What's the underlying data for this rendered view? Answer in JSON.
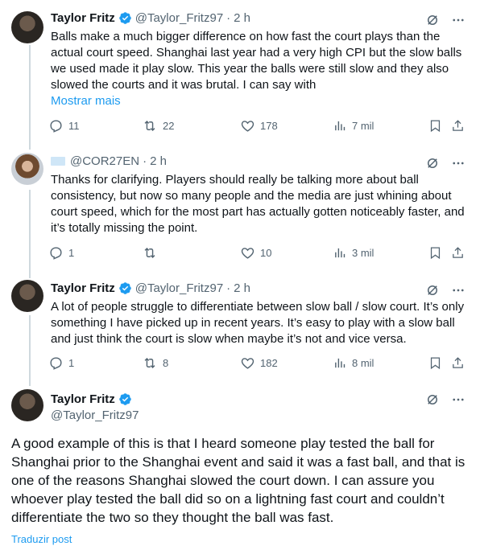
{
  "tweets": [
    {
      "name": "Taylor Fritz",
      "handle": "@Taylor_Fritz97",
      "dot": "·",
      "time": "2 h",
      "text": "Balls make a much bigger difference on how fast the court plays than the actual court speed. Shanghai last year had a very high CPI but the slow balls we used made it play slow. This year the balls were still slow and they also slowed the courts and it was brutal. I can say with",
      "more": "Mostrar mais",
      "replies": "11",
      "reposts": "22",
      "likes": "178",
      "views": "7 mil"
    },
    {
      "name": "",
      "handle": "@COR27EN",
      "dot": "·",
      "time": "2 h",
      "text": "Thanks for clarifying. Players should really be talking more about ball consistency, but now so many people and the media are just whining about court speed, which for the most part has actually gotten noticeably faster, and it’s totally missing the point.",
      "replies": "1",
      "reposts": "",
      "likes": "10",
      "views": "3 mil"
    },
    {
      "name": "Taylor Fritz",
      "handle": "@Taylor_Fritz97",
      "dot": "·",
      "time": "2 h",
      "text": "A lot of people struggle to differentiate between slow ball / slow court. It’s only something I have picked up in recent years. It’s easy to play with a slow ball and just think the court is slow when maybe it’s not and vice versa.",
      "replies": "1",
      "reposts": "8",
      "likes": "182",
      "views": "8 mil"
    }
  ],
  "focus": {
    "name": "Taylor Fritz",
    "handle": "@Taylor_Fritz97",
    "text": "A good example of this is that I heard someone play tested the ball for Shanghai prior to the Shanghai event and said it was a fast ball, and that is one of the reasons Shanghai slowed the court down. I can assure you whoever play tested the ball did so on a lightning fast court and couldn’t differentiate the two so they thought the ball was fast.",
    "translate": "Traduzir post"
  },
  "colors": {
    "accent": "#1d9bf0",
    "muted": "#536471",
    "text": "#0f1419",
    "thread_line": "#cfd9de"
  },
  "icons": [
    "verified-badge-icon",
    "grok-icon",
    "more-icon",
    "reply-icon",
    "repost-icon",
    "like-icon",
    "views-icon",
    "bookmark-icon",
    "share-icon"
  ]
}
